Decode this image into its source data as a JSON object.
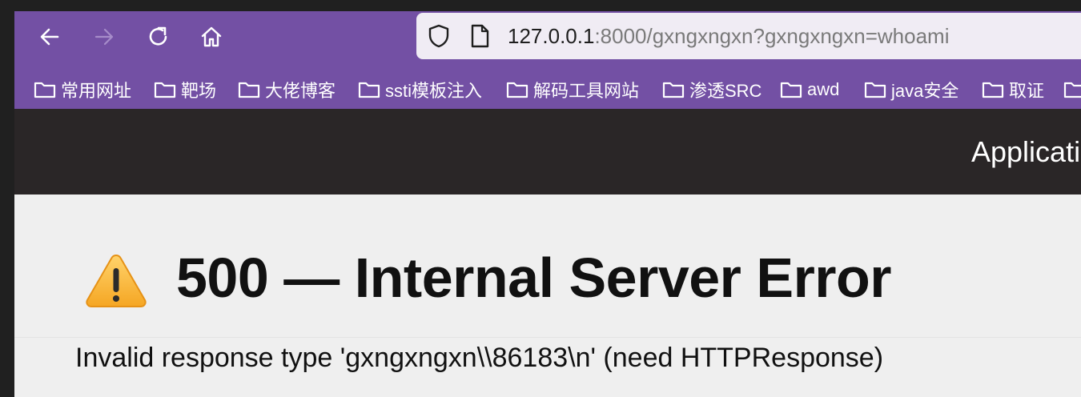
{
  "browser": {
    "url": {
      "host": "127.0.0.1",
      "rest": ":8000/gxngxngxn?gxngxngxn=whoami"
    },
    "bookmarks": [
      {
        "label": "常用网址"
      },
      {
        "label": "靶场"
      },
      {
        "label": "大佬博客"
      },
      {
        "label": "ssti模板注入"
      },
      {
        "label": "解码工具网站"
      },
      {
        "label": "渗透SRC"
      },
      {
        "label": "awd"
      },
      {
        "label": "java安全"
      },
      {
        "label": "取证"
      },
      {
        "label": ""
      }
    ],
    "colors": {
      "chrome": "#7350a4",
      "urlbar": "#f0ecf4"
    }
  },
  "app": {
    "header_title": "Applicati"
  },
  "error": {
    "icon": "warning-icon",
    "title": "500 — Internal Server Error",
    "message": "Invalid response type 'gxngxngxn\\\\86183\\n' (need HTTPResponse)"
  }
}
